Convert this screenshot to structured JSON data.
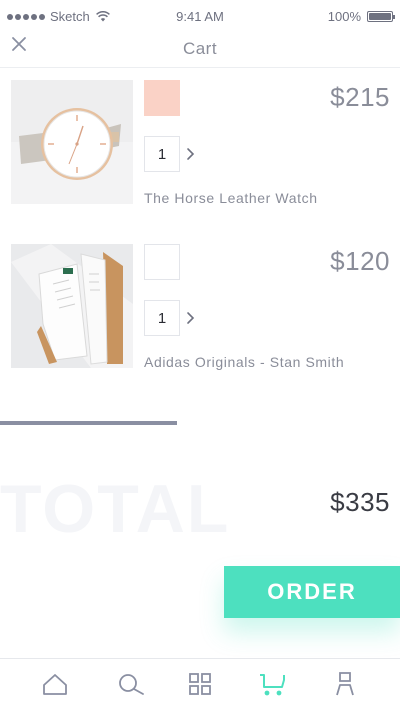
{
  "status_bar": {
    "carrier": "Sketch",
    "time": "9:41 AM",
    "battery": "100%"
  },
  "header": {
    "title": "Cart"
  },
  "items": [
    {
      "name": "The Horse Leather Watch",
      "price": "$215",
      "quantity": "1",
      "swatch_color": "#fad2c6"
    },
    {
      "name": "Adidas Originals - Stan Smith",
      "price": "$120",
      "quantity": "1",
      "swatch_color": "#ffffff"
    }
  ],
  "total": {
    "label": "TOTAL",
    "amount": "$335"
  },
  "order_button": {
    "label": "ORDER"
  },
  "tab_bar": {
    "tabs": [
      {
        "icon": "home-icon",
        "active": false
      },
      {
        "icon": "search-icon",
        "active": false
      },
      {
        "icon": "grid-icon",
        "active": false
      },
      {
        "icon": "cart-icon",
        "active": true
      },
      {
        "icon": "profile-icon",
        "active": false
      }
    ]
  },
  "colors": {
    "accent": "#4de0bf",
    "text_muted": "#8a8d99",
    "text_dark": "#3a3c44"
  }
}
